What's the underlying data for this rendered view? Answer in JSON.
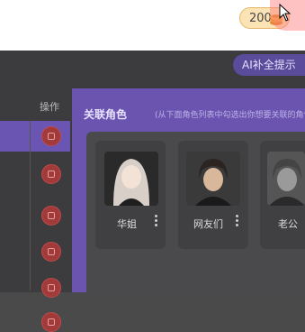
{
  "header": {
    "coin_balance": "200"
  },
  "ai_button": {
    "label": "AI补全提示"
  },
  "table": {
    "column_left": "",
    "column_ops": "操作",
    "row_count": 6
  },
  "panel": {
    "title": "关联角色",
    "subtitle": "(从下面角色列表中勾选出你想要关联的角色"
  },
  "characters": [
    {
      "name": "华姐"
    },
    {
      "name": "网友们"
    },
    {
      "name": "老公"
    }
  ],
  "colors": {
    "accent": "#6a54b0",
    "coin_bg": "#fce3b6",
    "danger": "#a23a3a"
  }
}
